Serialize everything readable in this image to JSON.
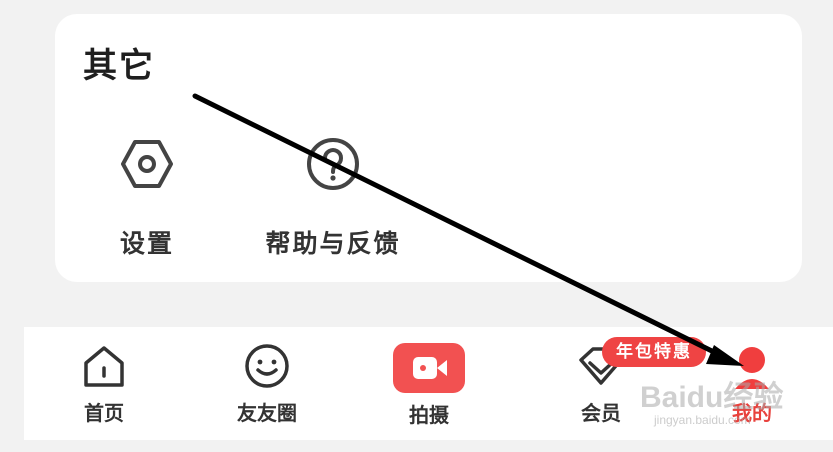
{
  "section": {
    "title": "其它",
    "items": [
      {
        "label": "设置",
        "icon": "settings-hexagon-icon"
      },
      {
        "label": "帮助与反馈",
        "icon": "help-question-icon"
      }
    ]
  },
  "tabbar": {
    "tabs": [
      {
        "label": "首页",
        "icon": "home-icon",
        "active": false
      },
      {
        "label": "友友圈",
        "icon": "smile-face-icon",
        "active": false
      },
      {
        "label": "拍摄",
        "icon": "video-camera-icon",
        "active": false
      },
      {
        "label": "会员",
        "icon": "diamond-icon",
        "active": false
      },
      {
        "label": "我的",
        "icon": "user-icon",
        "active": true
      }
    ],
    "promo_badge": "年包特惠"
  },
  "watermark": {
    "brand": "Baidu经验",
    "url": "jingyan.baidu.com"
  },
  "colors": {
    "accent": "#ef4444",
    "card_bg": "#ffffff",
    "page_bg": "#f2f2f2"
  }
}
